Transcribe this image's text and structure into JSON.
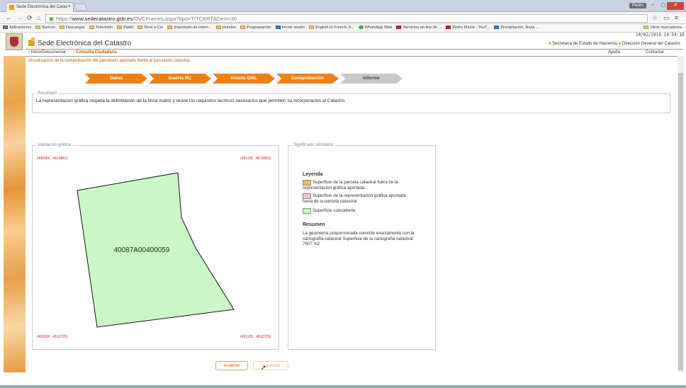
{
  "browser": {
    "tab_title": "Sede Electrónica del Catas",
    "user": "Pedro",
    "url_scheme": "https://",
    "url_host": "www.sedecatastro.gob.es",
    "url_path": "/OVCFrames.aspx?tipo=TITCERT&Dest=30",
    "window_buttons": [
      "–",
      "▢",
      "✕"
    ]
  },
  "bookmarks": [
    {
      "label": "Aplicaciones",
      "icon": "apps-icon"
    },
    {
      "label": "Bancos",
      "icon": "folder-icon"
    },
    {
      "label": "Descargas",
      "icon": "folder-icon"
    },
    {
      "label": "Televisión",
      "icon": "folder-icon"
    },
    {
      "label": "Pádel",
      "icon": "folder-icon"
    },
    {
      "label": "Rent a Car",
      "icon": "folder-icon"
    },
    {
      "label": "Importado de Intern...",
      "icon": "folder-icon"
    },
    {
      "label": "Hoteles",
      "icon": "folder-icon"
    },
    {
      "label": "Programación",
      "icon": "folder-icon"
    },
    {
      "label": "Iniciar sesión",
      "icon": "windows-icon"
    },
    {
      "label": "English to French, It...",
      "icon": "folder-icon"
    },
    {
      "label": "WhatsApp Web",
      "icon": "whatsapp-icon"
    },
    {
      "label": "Servicios on-line de ...",
      "icon": "red-icon"
    },
    {
      "label": "Pedro Maciá - YouT...",
      "icon": "youtube-icon"
    },
    {
      "label": "Precipitación, lluvia ...",
      "icon": "blue-icon"
    }
  ],
  "other_bookmarks": "Otros marcadores",
  "page": {
    "date": "10/02/2016 14:54:10",
    "site_title": "Sede Electrónica del Catastro",
    "top_links": [
      "Secretaría de Estado de Hacienda",
      "Dirección General del Catastro"
    ],
    "nav": {
      "home": "Inicio/Desconectar",
      "consulta": "Consulta Ciudadana",
      "help": "Ayuda",
      "contact": "Contactar"
    },
    "breadcrumb": "Visualización de la comprobación del parcelario aportado frente al parcelario catastral.",
    "steps": [
      {
        "label": "Datos",
        "active": true
      },
      {
        "label": "Inserta RC",
        "active": true
      },
      {
        "label": "Inserta GML",
        "active": true
      },
      {
        "label": "Comprobación",
        "active": true
      },
      {
        "label": "Informe",
        "active": false
      }
    ],
    "result": {
      "legend": "Resultado",
      "text": "La representación gráfica respeta la delimitación de la finca matriz y reúne los requisitos técnicos necesarios que permiten su incorporación al Catastro."
    },
    "validation": {
      "legend": "Validación gráfica",
      "coords": {
        "top_left": "(400966 , 4510861)",
        "top_right": "(401135 , 4510861)",
        "bottom_left": "(400966 , 4510726)",
        "bottom_right": "(401135 , 4510726)"
      },
      "parcel_label": "40087A00400059",
      "parcel_fill": "#ccf6c8"
    },
    "symbols": {
      "legend": "Significado simbólico",
      "title": "Leyenda",
      "items": [
        {
          "text": "Superficie de la parcela catastral fuera de la representación gráfica aportada",
          "color": "#f5b860"
        },
        {
          "text": "Superficie de la representación gráfica aportada fuera de la parcela catastral",
          "color": "#f8c6c6"
        },
        {
          "text": "Superficie coincidente",
          "color": "#ccf6c8"
        }
      ],
      "summary_title": "Resumen",
      "summary_text": "La geometría proporcionada coincide exactamente con la cartografía catastral Superficie de la cartografía catastral: 7607 m2"
    },
    "buttons": {
      "prev": "Anterior",
      "next": "Siguiente"
    }
  },
  "colors": {
    "accent": "#f07f17",
    "link": "#c55a00"
  }
}
